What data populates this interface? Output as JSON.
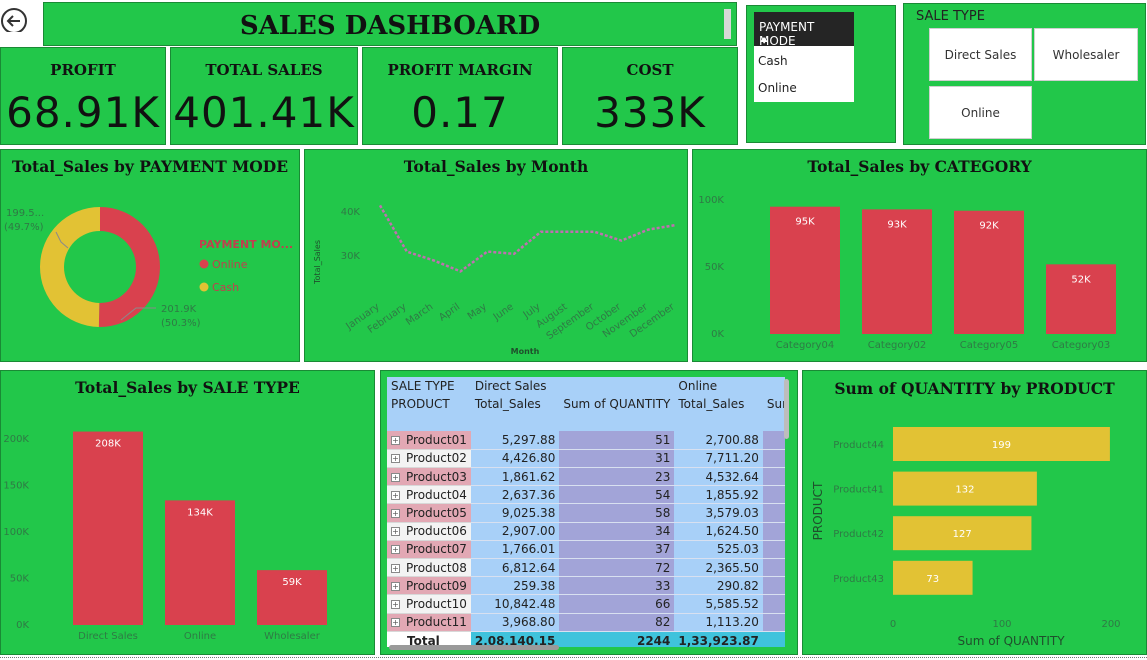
{
  "title": "SALES DASHBOARD",
  "kpis": [
    {
      "label": "PROFIT",
      "value": "68.91K"
    },
    {
      "label": "TOTAL SALES",
      "value": "401.41K"
    },
    {
      "label": "PROFIT MARGIN",
      "value": "0.17"
    },
    {
      "label": "COST",
      "value": "333K"
    }
  ],
  "payment_slicer": {
    "header": "PAYMENT MODE",
    "options": [
      "Cash",
      "Online"
    ]
  },
  "sale_type_slicer": {
    "header": "SALE TYPE",
    "options": [
      "Direct Sales",
      "Wholesaler",
      "Online"
    ]
  },
  "chart_data": [
    {
      "type": "pie",
      "title": "Total_Sales by PAYMENT MODE",
      "legend_title": "PAYMENT MO...",
      "legend": "right",
      "slices": [
        {
          "name": "Online",
          "value": 201.9,
          "label": "201.9K",
          "pct": "(50.3%)",
          "color": "#d9414e"
        },
        {
          "name": "Cash",
          "value": 199.5,
          "label": "199.5...",
          "pct": "(49.7%)",
          "color": "#e2c234"
        }
      ]
    },
    {
      "type": "line",
      "title": "Total_Sales by Month",
      "xlabel": "Month",
      "ylabel": "Total_Sales",
      "categories": [
        "January",
        "February",
        "March",
        "April",
        "May",
        "June",
        "July",
        "August",
        "September",
        "October",
        "November",
        "December"
      ],
      "values": [
        41500,
        31000,
        29000,
        26500,
        31000,
        30500,
        35500,
        35500,
        35500,
        33500,
        36000,
        37000
      ],
      "ylim": [
        20000,
        45000
      ],
      "yticks": [
        "40K",
        "30K"
      ],
      "color": "#c070b0"
    },
    {
      "type": "bar",
      "title": "Total_Sales by CATEGORY",
      "categories": [
        "Category04",
        "Category02",
        "Category05",
        "Category03"
      ],
      "values": [
        95,
        93,
        92,
        52
      ],
      "labels": [
        "95K",
        "93K",
        "92K",
        "52K"
      ],
      "ylim": [
        0,
        100
      ],
      "yticks": [
        "100K",
        "50K",
        "0K"
      ],
      "color": "#d9414e"
    },
    {
      "type": "bar",
      "title": "Total_Sales by SALE TYPE",
      "categories": [
        "Direct Sales",
        "Online",
        "Wholesaler"
      ],
      "values": [
        208,
        134,
        59
      ],
      "labels": [
        "208K",
        "134K",
        "59K"
      ],
      "ylim": [
        0,
        200
      ],
      "yticks": [
        "200K",
        "150K",
        "100K",
        "50K",
        "0K"
      ],
      "color": "#d9414e"
    },
    {
      "type": "bar",
      "orientation": "horizontal",
      "title": "Sum of QUANTITY by PRODUCT",
      "xlabel": "Sum of QUANTITY",
      "ylabel": "PRODUCT",
      "categories": [
        "Product44",
        "Product41",
        "Product42",
        "Product43"
      ],
      "values": [
        199,
        132,
        127,
        73
      ],
      "xlim": [
        0,
        200
      ],
      "xticks": [
        "0",
        "100",
        "200"
      ],
      "color": "#e2c234"
    }
  ],
  "matrix": {
    "header_row1": [
      "SALE TYPE",
      "Direct Sales",
      "",
      "Online",
      ""
    ],
    "header_row2": [
      "PRODUCT",
      "Total_Sales",
      "Sum of QUANTITY",
      "Total_Sales",
      "Sum of Q"
    ],
    "rows": [
      [
        "Product01",
        "5,297.88",
        "51",
        "2,700.88"
      ],
      [
        "Product02",
        "4,426.80",
        "31",
        "7,711.20"
      ],
      [
        "Product03",
        "1,861.62",
        "23",
        "4,532.64"
      ],
      [
        "Product04",
        "2,637.36",
        "54",
        "1,855.92"
      ],
      [
        "Product05",
        "9,025.38",
        "58",
        "3,579.03"
      ],
      [
        "Product06",
        "2,907.00",
        "34",
        "1,624.50"
      ],
      [
        "Product07",
        "1,766.01",
        "37",
        "525.03"
      ],
      [
        "Product08",
        "6,812.64",
        "72",
        "2,365.50"
      ],
      [
        "Product09",
        "259.38",
        "33",
        "290.82"
      ],
      [
        "Product10",
        "10,842.48",
        "66",
        "5,585.52"
      ],
      [
        "Product11",
        "3,968.80",
        "82",
        "1,113.20"
      ]
    ],
    "total": [
      "Total",
      "2,08,140.15",
      "2244",
      "1,33,923.87"
    ]
  },
  "colors": {
    "panel": "#22c74a",
    "bar": "#d9414e",
    "cash": "#e2c234",
    "line": "#c070b0"
  }
}
